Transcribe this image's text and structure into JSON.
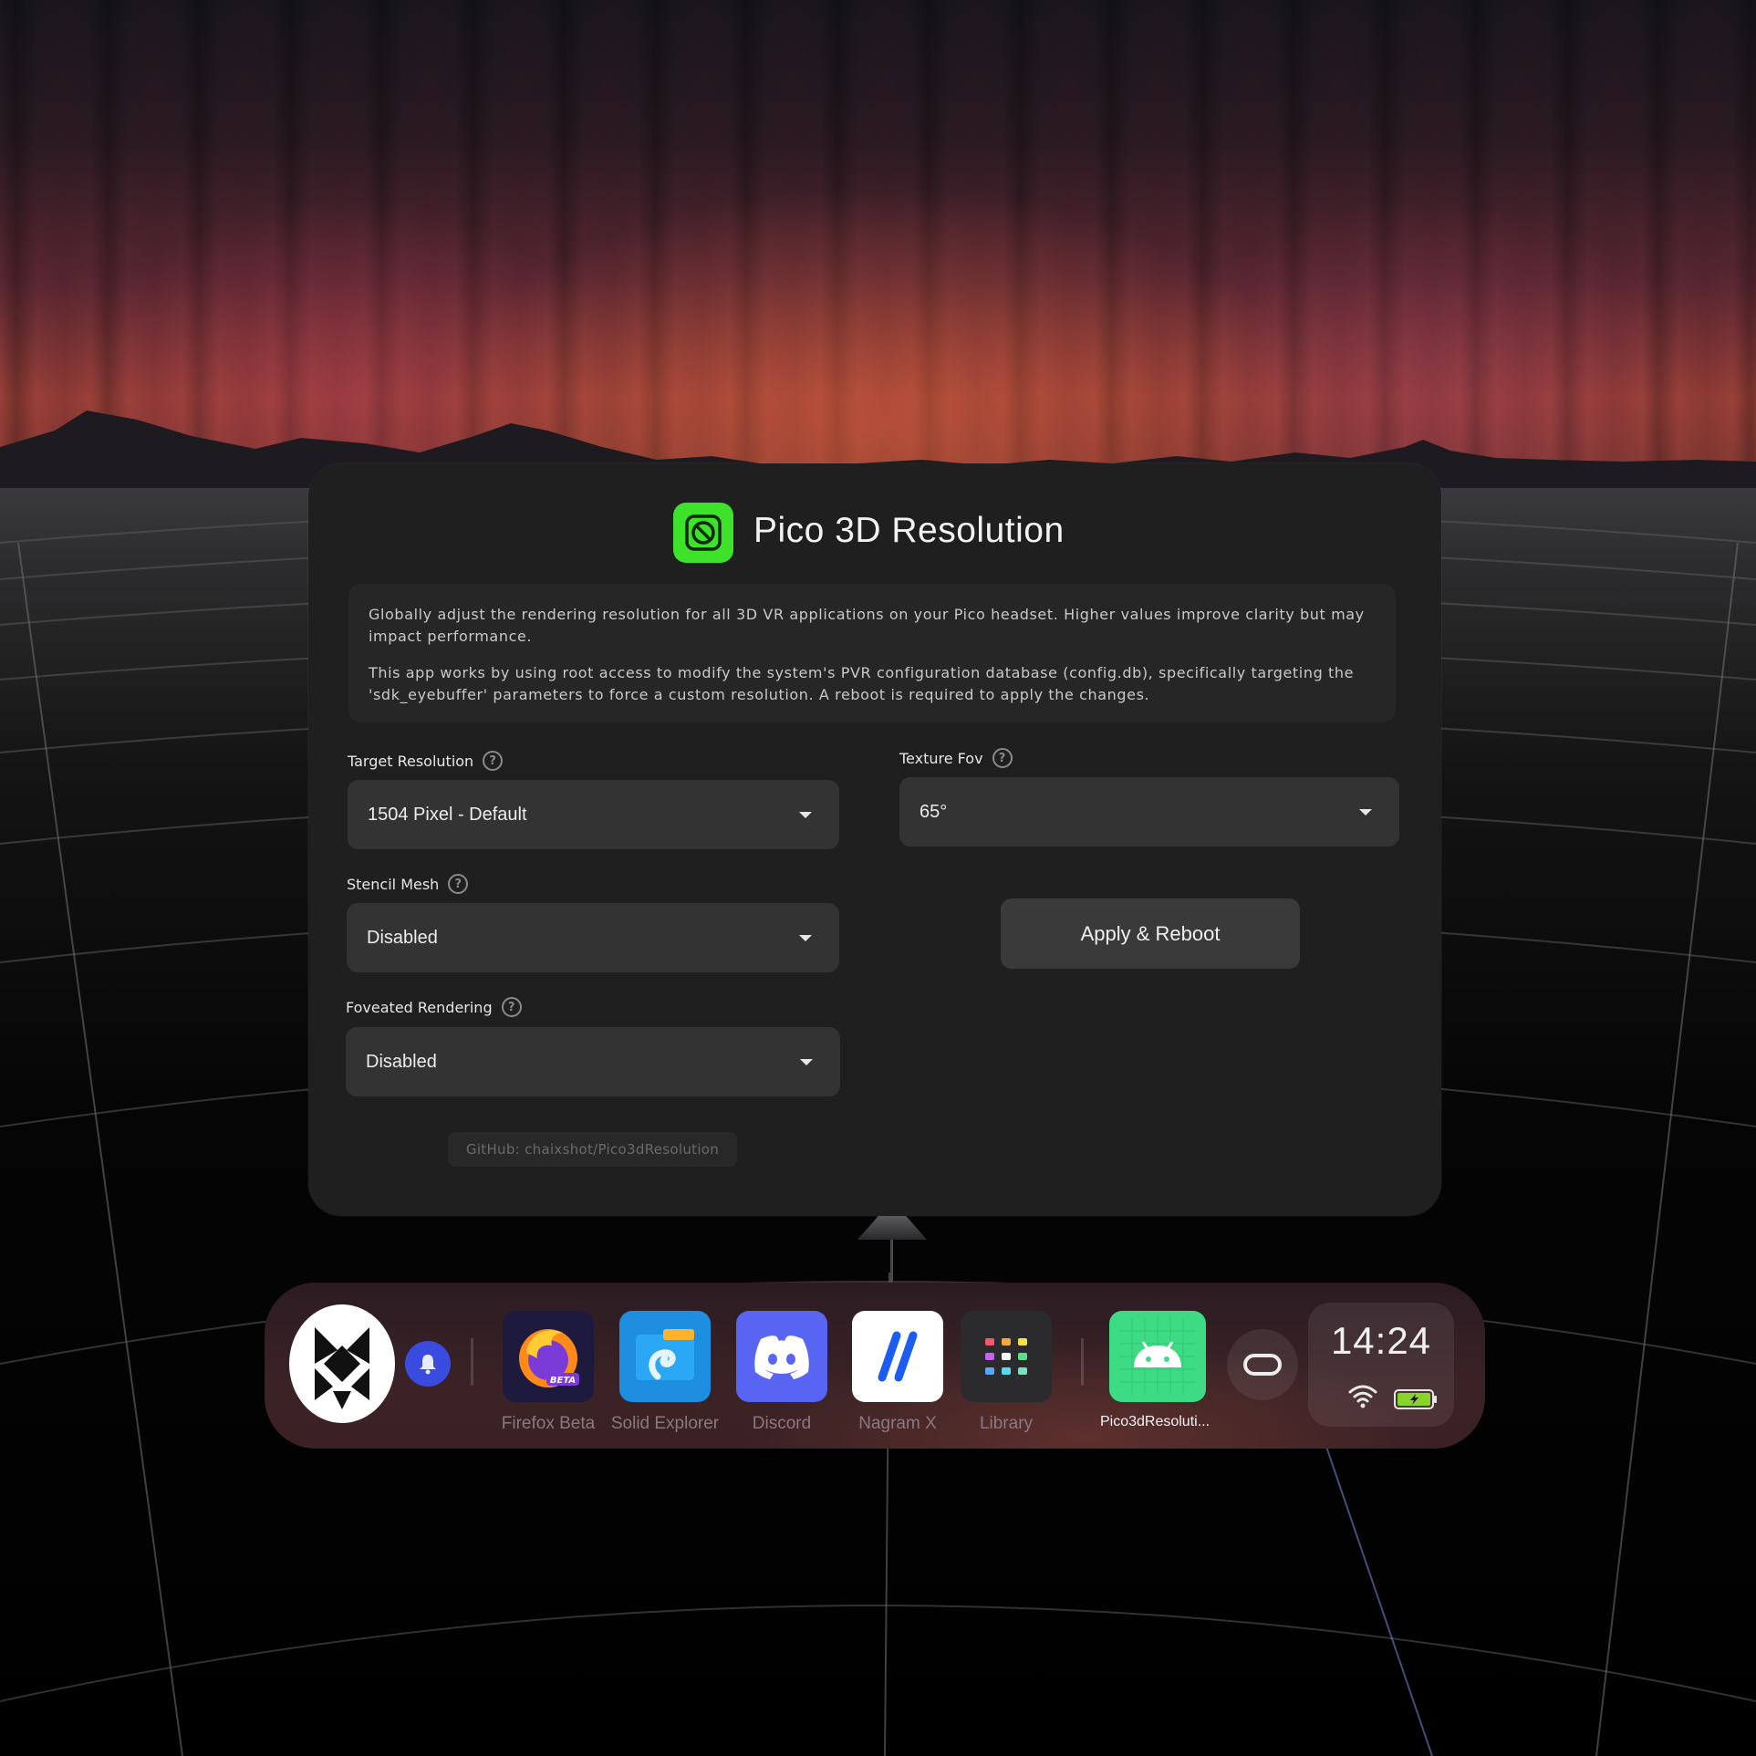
{
  "app": {
    "title": "Pico 3D Resolution",
    "description_1": "Globally adjust the rendering resolution for all 3D VR applications on your Pico headset. Higher values improve clarity but may impact performance.",
    "description_2": "This app works by using root access to modify the system's PVR configuration database (config.db), specifically targeting the 'sdk_eyebuffer' parameters to force a custom resolution. A reboot is required to apply the changes.",
    "target_resolution": {
      "label": "Target Resolution",
      "value": "1504 Pixel - Default"
    },
    "texture_fov": {
      "label": "Texture Fov",
      "value": "65°"
    },
    "stencil_mesh": {
      "label": "Stencil Mesh",
      "value": "Disabled"
    },
    "foveated_rendering": {
      "label": "Foveated Rendering",
      "value": "Disabled"
    },
    "apply_button": "Apply & Reboot",
    "github_link": "GitHub: chaixshot/Pico3dResolution",
    "accent_color": "#3ee22a"
  },
  "dock": {
    "apps": [
      {
        "label": "Firefox Beta",
        "icon": "firefox-beta-icon"
      },
      {
        "label": "Solid Explorer",
        "icon": "solid-explorer-icon"
      },
      {
        "label": "Discord",
        "icon": "discord-icon"
      },
      {
        "label": "Nagram X",
        "icon": "nagram-x-icon"
      },
      {
        "label": "Library",
        "icon": "library-grid-icon"
      },
      {
        "label": "Pico3dResoluti...",
        "icon": "android-icon"
      }
    ],
    "time": "14:24",
    "firefox_badge": "BETA"
  }
}
